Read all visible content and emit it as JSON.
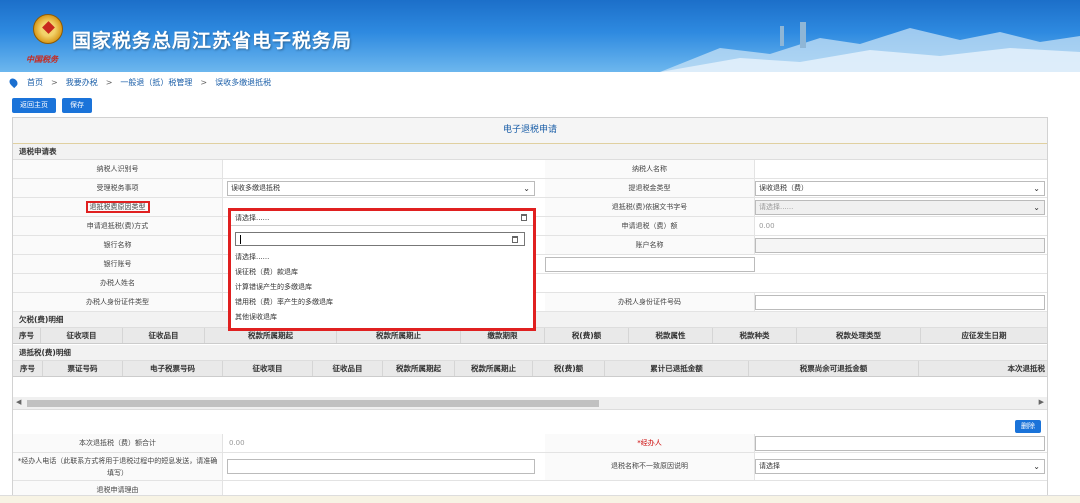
{
  "header": {
    "title": "国家税务总局江苏省电子税务局",
    "seal_text": "中国税务"
  },
  "breadcrumb": [
    "首页",
    "我要办税",
    "一般退（抵）税管理",
    "误收多缴退抵税"
  ],
  "breadcrumb_sep": ">",
  "toolbar": {
    "back_label": "返回主页",
    "save_label": "保存"
  },
  "sheet_title": "电子退税申请",
  "sections": {
    "apply": "退税申请表",
    "owe": "欠税(费)明细",
    "refund": "退抵税(费)明细"
  },
  "form": {
    "taxpayer_id": "纳税人识别号",
    "taxpayer_name": "纳税人名称",
    "accept_item": "受理税务事项",
    "accept_item_value": "误收多缴退抵税",
    "refund_type": "提退税金类型",
    "refund_type_value": "误收退税（费）",
    "reason_type": "退抵税费原因类型",
    "reason_value": "请选择......",
    "doc_no": "退抵税(费)依据文书字号",
    "doc_no_placeholder": "请选择......",
    "method": "申请退抵税(费)方式",
    "amount": "申请退税（费）额",
    "amount_value": "0.00",
    "bank_name": "银行名称",
    "account_name": "账户名称",
    "bank_account": "银行账号",
    "agent_name": "办税人姓名",
    "id_type": "办税人身份证件类型",
    "id_no": "办税人身份证件号码"
  },
  "dropdown": {
    "selected": "请选择......",
    "options": [
      "请选择......",
      "误征税（费）款退库",
      "计算错误产生的多缴退库",
      "错用税（费）率产生的多缴退库",
      "其他误收退库"
    ]
  },
  "owe_columns": [
    "序号",
    "征收项目",
    "征收品目",
    "税款所属期起",
    "税款所属期止",
    "缴款期限",
    "税(费)额",
    "税款属性",
    "税款种类",
    "税款处理类型",
    "应征发生日期"
  ],
  "refund_columns": [
    "序号",
    "票证号码",
    "电子税票号码",
    "征收项目",
    "征收品目",
    "税款所属期起",
    "税款所属期止",
    "税(费)额",
    "累计已退抵金额",
    "税票尚余可退抵金额",
    "本次退抵税"
  ],
  "delete_label": "删除",
  "bottom": {
    "total_label": "本次退抵税（费）额合计",
    "total_value": "0.00",
    "handler_label": "*经办人",
    "phone_label": "*经办人电话（此联系方式将用于退税过程中的短息发送，请准确填写）",
    "mismatch_label": "退税名称不一致原因说明",
    "mismatch_value": "请选择",
    "reason_label": "退税申请理由"
  },
  "colors": {
    "accent": "#1a73d9",
    "highlight": "#e02020"
  }
}
